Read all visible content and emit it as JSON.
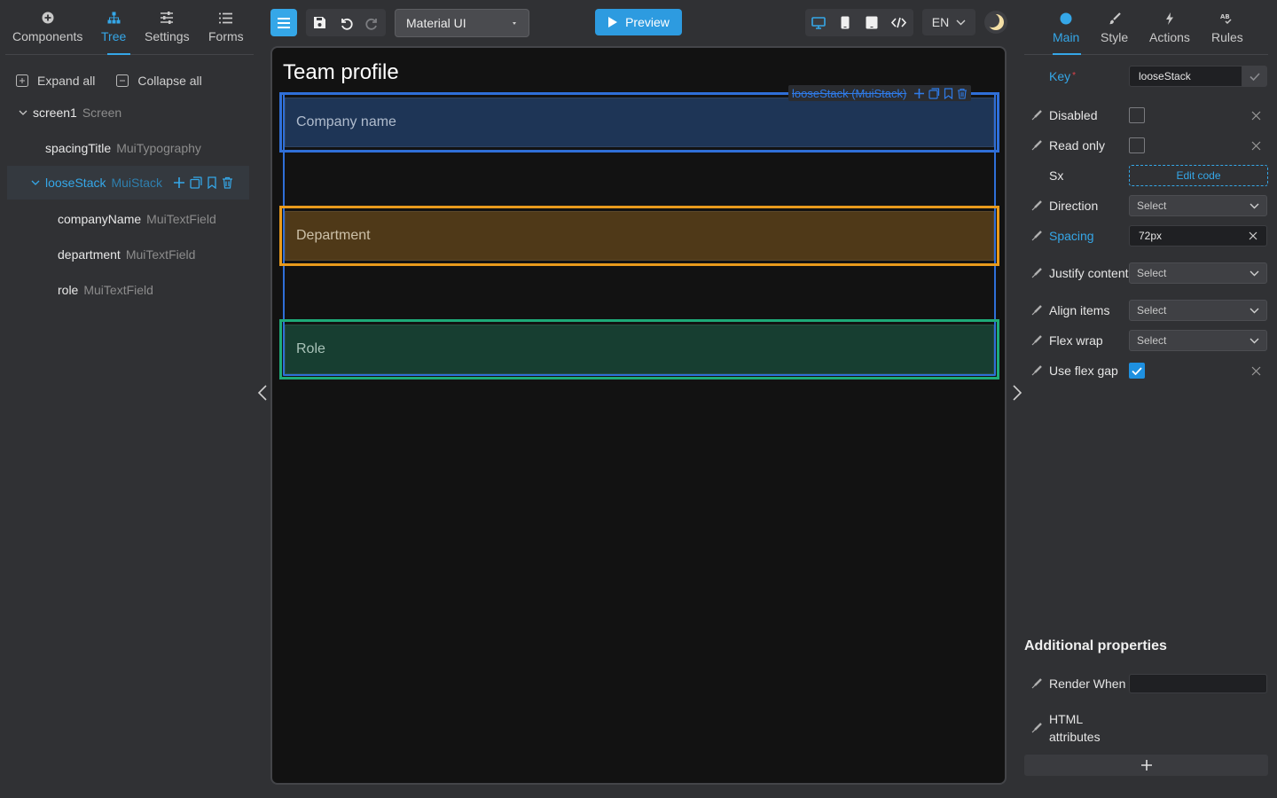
{
  "left_tabs": [
    {
      "label": "Components",
      "icon": "plus-circle-icon"
    },
    {
      "label": "Tree",
      "icon": "sitemap-icon",
      "active": true
    },
    {
      "label": "Settings",
      "icon": "sliders-icon"
    },
    {
      "label": "Forms",
      "icon": "list-icon"
    }
  ],
  "tree_actions": {
    "expand_all": "Expand all",
    "collapse_all": "Collapse all"
  },
  "tree": [
    {
      "name": "screen1",
      "type": "Screen"
    },
    {
      "name": "spacingTitle",
      "type": "MuiTypography"
    },
    {
      "name": "looseStack",
      "type": "MuiStack",
      "selected": true
    },
    {
      "name": "companyName",
      "type": "MuiTextField"
    },
    {
      "name": "department",
      "type": "MuiTextField"
    },
    {
      "name": "role",
      "type": "MuiTextField"
    }
  ],
  "toolbar": {
    "library": "Material UI",
    "preview": "Preview",
    "language": "EN"
  },
  "canvas": {
    "title": "Team profile",
    "stack_tag": "looseStack (MuiStack)",
    "fields": {
      "company": "Company name",
      "department": "Department",
      "role": "Role"
    }
  },
  "right_tabs": [
    {
      "label": "Main",
      "icon": "circle-icon",
      "active": true
    },
    {
      "label": "Style",
      "icon": "brush-icon"
    },
    {
      "label": "Actions",
      "icon": "bolt-icon"
    },
    {
      "label": "Rules",
      "icon": "rules-icon"
    }
  ],
  "props": {
    "key_label": "Key",
    "key_required": "*",
    "key_value": "looseStack",
    "disabled": "Disabled",
    "read_only": "Read only",
    "sx": "Sx",
    "edit_code": "Edit code",
    "direction": "Direction",
    "direction_value": "Select",
    "spacing": "Spacing",
    "spacing_value": "72px",
    "justify": "Justify content",
    "justify_value": "Select",
    "align": "Align items",
    "align_value": "Select",
    "flexwrap": "Flex wrap",
    "flexwrap_value": "Select",
    "flexgap": "Use flex gap",
    "flexgap_checked": true,
    "disabled_checked": false,
    "read_only_checked": false
  },
  "additional": {
    "title": "Additional properties",
    "render_when": "Render When",
    "html_attributes": "HTML attributes"
  },
  "colors": {
    "accent": "#35a7e8",
    "stack_outline": "#2f6fd8",
    "department_outline": "#e89a1c",
    "role_outline": "#1eaa78"
  }
}
